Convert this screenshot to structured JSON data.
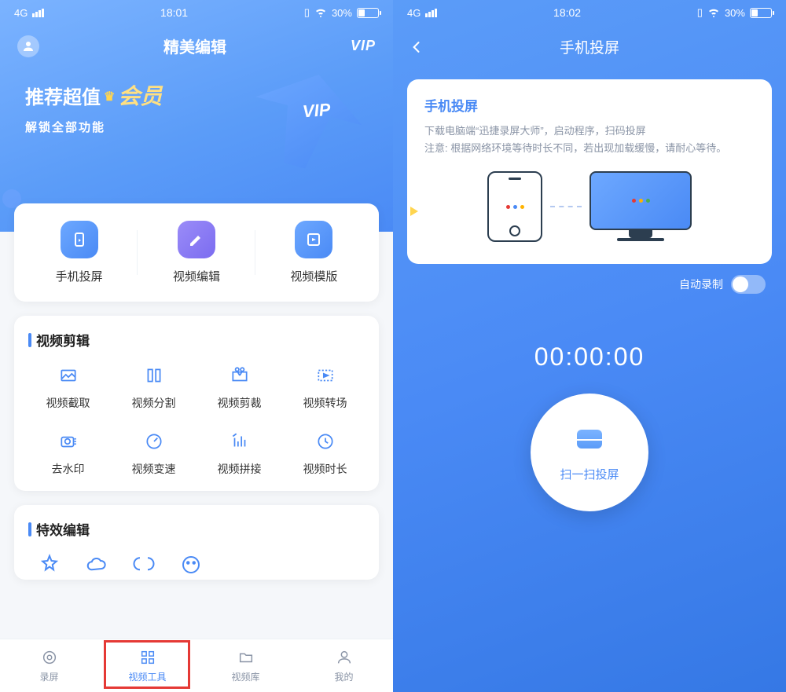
{
  "left": {
    "status": {
      "network": "4G",
      "time": "18:01",
      "battery": "30%"
    },
    "hero": {
      "title": "精美编辑",
      "vip": "VIP",
      "line1a": "推荐超值",
      "line1b": "会员",
      "line2": "解锁全部功能",
      "arrow_vip": "VIP"
    },
    "main_items": [
      {
        "label": "手机投屏"
      },
      {
        "label": "视频编辑"
      },
      {
        "label": "视频模版"
      }
    ],
    "section1_title": "视频剪辑",
    "grid": [
      {
        "label": "视频截取"
      },
      {
        "label": "视频分割"
      },
      {
        "label": "视频剪裁"
      },
      {
        "label": "视频转场"
      },
      {
        "label": "去水印"
      },
      {
        "label": "视频变速"
      },
      {
        "label": "视频拼接"
      },
      {
        "label": "视频时长"
      }
    ],
    "section2_title": "特效编辑",
    "tabs": [
      {
        "label": "录屏"
      },
      {
        "label": "视频工具"
      },
      {
        "label": "视频库"
      },
      {
        "label": "我的"
      }
    ]
  },
  "right": {
    "status": {
      "network": "4G",
      "time": "18:02",
      "battery": "30%"
    },
    "title": "手机投屏",
    "card": {
      "title": "手机投屏",
      "desc": "下载电脑端“迅捷录屏大师”，启动程序，扫码投屏\n注意: 根据网络环境等待时长不同，若出现加载缓慢，请耐心等待。"
    },
    "auto_record": "自动录制",
    "timer": "00:00:00",
    "scan_label": "扫一扫投屏"
  }
}
